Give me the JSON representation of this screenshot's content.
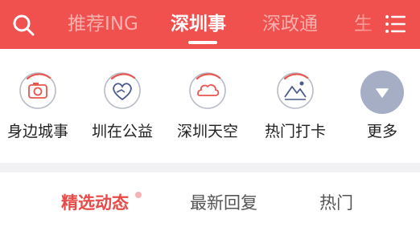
{
  "header": {
    "tabs": [
      {
        "label": "推荐ING"
      },
      {
        "label": "深圳事"
      },
      {
        "label": "深政通"
      },
      {
        "label": "生"
      }
    ],
    "active_tab": "深圳事"
  },
  "shortcuts": [
    {
      "label": "身边城事",
      "icon": "camera-icon"
    },
    {
      "label": "圳在公益",
      "icon": "heart-hand-icon"
    },
    {
      "label": "深圳天空",
      "icon": "cloud-icon"
    },
    {
      "label": "热门打卡",
      "icon": "landscape-icon"
    },
    {
      "label": "更多",
      "icon": "chevron-down-icon"
    }
  ],
  "subtabs": [
    {
      "label": "精选动态"
    },
    {
      "label": "最新回复"
    },
    {
      "label": "热门"
    }
  ],
  "colors": {
    "brand_red": "#f0504e",
    "active_subtab": "#e84a47",
    "more_button": "#a6aec6"
  }
}
